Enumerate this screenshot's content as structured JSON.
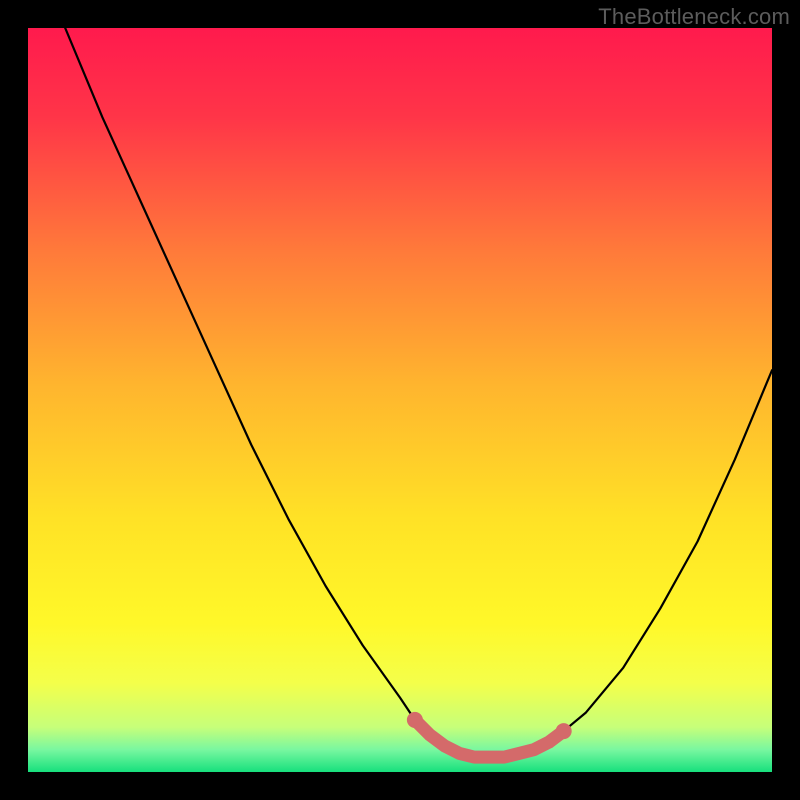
{
  "watermark": "TheBottleneck.com",
  "chart_data": {
    "type": "line",
    "title": "",
    "xlabel": "",
    "ylabel": "",
    "xlim": [
      0,
      100
    ],
    "ylim": [
      0,
      100
    ],
    "series": [
      {
        "name": "bottleneck-curve",
        "x": [
          0,
          5,
          10,
          15,
          20,
          25,
          30,
          35,
          40,
          45,
          50,
          52,
          54,
          56,
          58,
          60,
          62,
          64,
          66,
          68,
          70,
          72,
          75,
          80,
          85,
          90,
          95,
          100
        ],
        "values": [
          112,
          100,
          88,
          77,
          66,
          55,
          44,
          34,
          25,
          17,
          10,
          7,
          5,
          3.5,
          2.5,
          2,
          2,
          2,
          2.5,
          3,
          4,
          5.5,
          8,
          14,
          22,
          31,
          42,
          54
        ]
      }
    ],
    "highlight": {
      "name": "bottleneck-valley-marker",
      "x": [
        52,
        54,
        56,
        58,
        60,
        62,
        64,
        66,
        68,
        70,
        72
      ],
      "values": [
        7,
        5,
        3.5,
        2.5,
        2,
        2,
        2,
        2.5,
        3,
        4,
        5.5
      ],
      "color": "#d46a6a"
    },
    "background_gradient": {
      "stops": [
        {
          "pos": 0.0,
          "color": "#ff1a4d"
        },
        {
          "pos": 0.12,
          "color": "#ff3548"
        },
        {
          "pos": 0.3,
          "color": "#ff7a3a"
        },
        {
          "pos": 0.48,
          "color": "#ffb52e"
        },
        {
          "pos": 0.66,
          "color": "#ffe226"
        },
        {
          "pos": 0.8,
          "color": "#fff829"
        },
        {
          "pos": 0.88,
          "color": "#f4ff4a"
        },
        {
          "pos": 0.94,
          "color": "#c6ff7a"
        },
        {
          "pos": 0.97,
          "color": "#79f7a0"
        },
        {
          "pos": 1.0,
          "color": "#17e07d"
        }
      ]
    }
  }
}
